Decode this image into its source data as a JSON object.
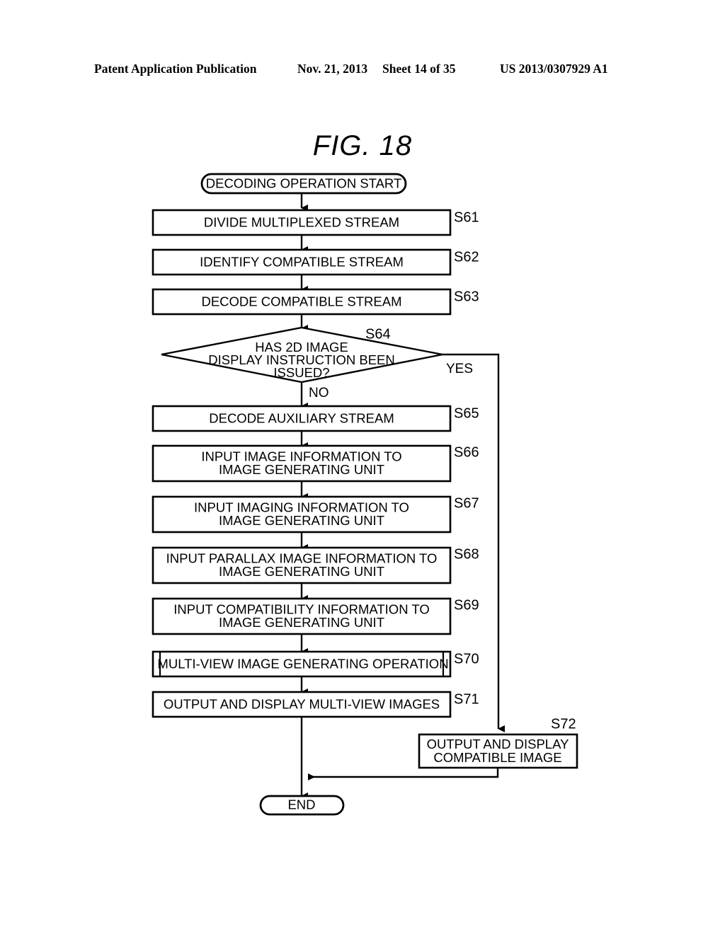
{
  "header": {
    "publication": "Patent Application Publication",
    "date": "Nov. 21, 2013",
    "sheet": "Sheet 14 of 35",
    "patent_number": "US 2013/0307929 A1"
  },
  "figure": {
    "title": "FIG. 18"
  },
  "flowchart": {
    "start": {
      "label": "DECODING OPERATION START"
    },
    "end": {
      "label": "END"
    },
    "branch_yes": "YES",
    "branch_no": "NO",
    "steps": [
      {
        "id": "S61",
        "line1": "DIVIDE MULTIPLEXED STREAM",
        "line2": "",
        "line3": ""
      },
      {
        "id": "S62",
        "line1": "IDENTIFY COMPATIBLE STREAM",
        "line2": "",
        "line3": ""
      },
      {
        "id": "S63",
        "line1": "DECODE COMPATIBLE STREAM",
        "line2": "",
        "line3": ""
      },
      {
        "id": "S64",
        "line1": "HAS 2D IMAGE",
        "line2": "DISPLAY INSTRUCTION BEEN",
        "line3": "ISSUED?"
      },
      {
        "id": "S65",
        "line1": "DECODE AUXILIARY STREAM",
        "line2": "",
        "line3": ""
      },
      {
        "id": "S66",
        "line1": "INPUT IMAGE INFORMATION TO",
        "line2": "IMAGE GENERATING UNIT",
        "line3": ""
      },
      {
        "id": "S67",
        "line1": "INPUT IMAGING INFORMATION TO",
        "line2": "IMAGE GENERATING UNIT",
        "line3": ""
      },
      {
        "id": "S68",
        "line1": "INPUT PARALLAX IMAGE INFORMATION TO",
        "line2": "IMAGE GENERATING UNIT",
        "line3": ""
      },
      {
        "id": "S69",
        "line1": "INPUT COMPATIBILITY INFORMATION TO",
        "line2": "IMAGE GENERATING UNIT",
        "line3": ""
      },
      {
        "id": "S70",
        "line1": "MULTI-VIEW IMAGE GENERATING OPERATION",
        "line2": "",
        "line3": ""
      },
      {
        "id": "S71",
        "line1": "OUTPUT AND DISPLAY MULTI-VIEW IMAGES",
        "line2": "",
        "line3": ""
      },
      {
        "id": "S72",
        "line1": "OUTPUT AND DISPLAY",
        "line2": "COMPATIBLE IMAGE",
        "line3": ""
      }
    ]
  },
  "colors": {
    "ink": "#000000",
    "paper": "#ffffff"
  }
}
